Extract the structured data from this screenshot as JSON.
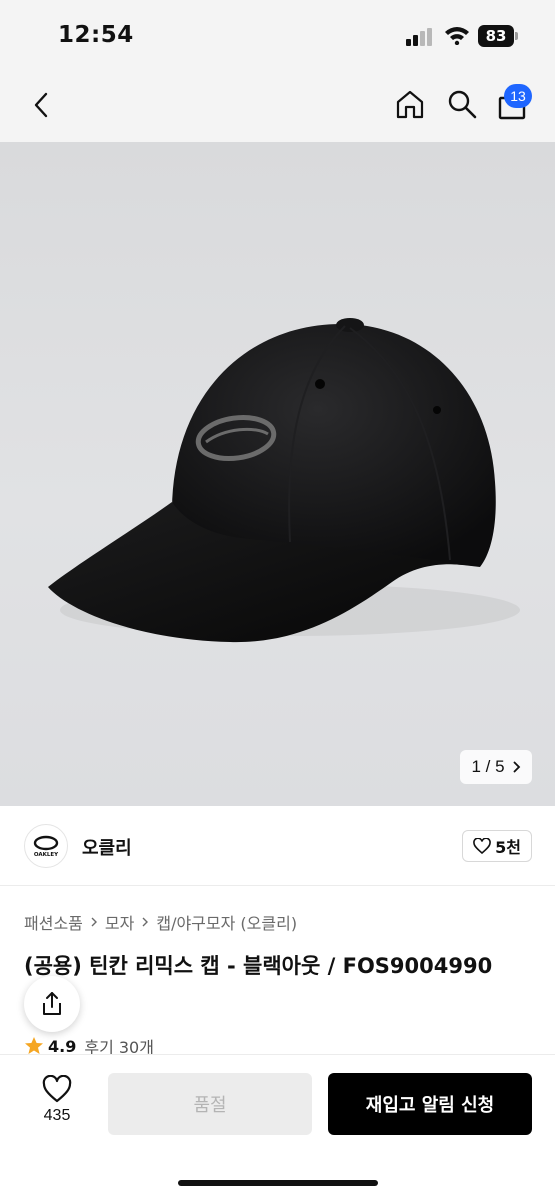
{
  "status_bar": {
    "time": "12:54",
    "battery": "83"
  },
  "header": {
    "cart_count": "13"
  },
  "gallery": {
    "counter": "1 / 5"
  },
  "brand": {
    "name": "오클리",
    "logo_text": "OAKLEY",
    "likes": "5천"
  },
  "breadcrumb": [
    "패션소품",
    "모자",
    "캡/야구모자 (오클리)"
  ],
  "product": {
    "title": "(공용) 틴칸 리믹스 캡 - 블랙아웃 / FOS9004990",
    "rating": "4.9",
    "reviews": "후기 30개"
  },
  "bottom_bar": {
    "wish_count": "435",
    "soldout_label": "품절",
    "restock_label": "재입고 알림 신청"
  },
  "colors": {
    "accent": "#1f66ff",
    "primary_button": "#000000",
    "disabled_button": "#ececec",
    "star": "#f5a623"
  }
}
